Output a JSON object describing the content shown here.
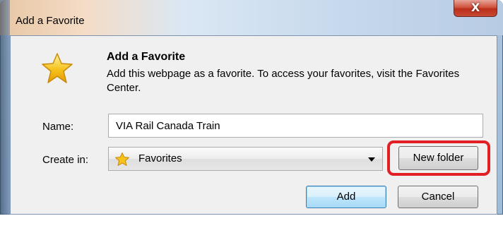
{
  "window": {
    "title": "Add a Favorite",
    "close_label": "X"
  },
  "dialog": {
    "heading": "Add a Favorite",
    "description": "Add this webpage as a favorite. To access your favorites, visit the Favorites Center."
  },
  "form": {
    "name_label": "Name:",
    "name_value": "VIA Rail Canada Train",
    "create_in_label": "Create in:",
    "create_in_value": "Favorites"
  },
  "buttons": {
    "new_folder": "New folder",
    "add": "Add",
    "cancel": "Cancel"
  },
  "icons": {
    "dialog_icon": "star-icon",
    "folder_icon": "favorites-star-icon",
    "dropdown_icon": "chevron-down-icon"
  },
  "colors": {
    "highlight": "#e31f26",
    "star": "#f6c21b"
  }
}
